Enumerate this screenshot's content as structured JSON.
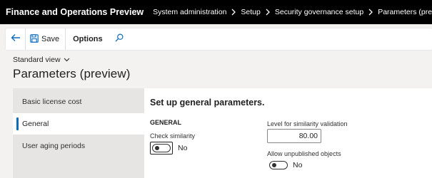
{
  "app": {
    "title": "Finance and Operations Preview"
  },
  "breadcrumb": {
    "items": [
      "System administration",
      "Setup",
      "Security governance setup",
      "Parameters (preview)"
    ]
  },
  "actionbar": {
    "save_label": "Save",
    "options_label": "Options"
  },
  "view": {
    "label": "Standard view"
  },
  "page": {
    "title": "Parameters (preview)"
  },
  "nav": {
    "items": [
      {
        "label": "Basic license cost",
        "active": false
      },
      {
        "label": "General",
        "active": true
      },
      {
        "label": "User aging periods",
        "active": false
      }
    ]
  },
  "content": {
    "heading": "Set up general parameters.",
    "group_label": "GENERAL",
    "check_similarity": {
      "label": "Check similarity",
      "value": "No"
    },
    "similarity_level": {
      "label": "Level for similarity validation",
      "value": "80.00"
    },
    "unpublished": {
      "label": "Allow unpublished objects",
      "value": "No"
    }
  },
  "colors": {
    "topbar": "#000000",
    "accent": "#0f6cbd",
    "background": "#f3f2f1"
  }
}
